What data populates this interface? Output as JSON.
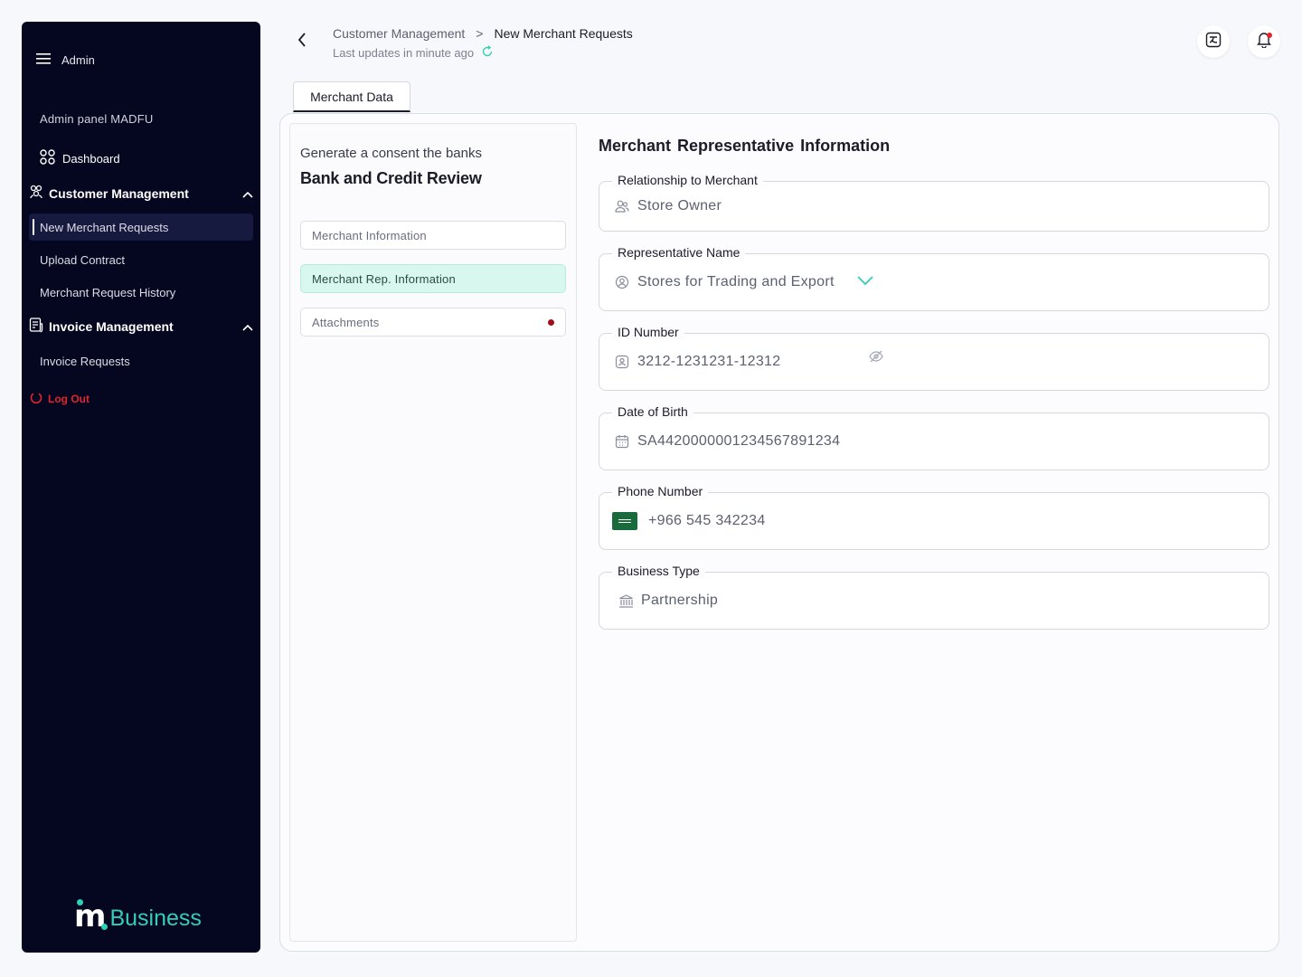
{
  "sidebar": {
    "admin_label": "Admin",
    "panel_title": "Admin panel MADFU",
    "dashboard_label": "Dashboard",
    "customer_section": "Customer Management",
    "customer_items": [
      "New Merchant Requests",
      "Upload Contract",
      "Merchant Request History"
    ],
    "invoice_section": "Invoice Management",
    "invoice_items": [
      "Invoice Requests"
    ],
    "logout_label": "Log Out",
    "logo_word": "Business",
    "active_item": "New Merchant Requests"
  },
  "header": {
    "breadcrumb_parent": "Customer Management",
    "breadcrumb_sep": ">",
    "breadcrumb_current": "New Merchant Requests",
    "last_updated": "Last updates in minute ago"
  },
  "tabs": [
    "Merchant Data"
  ],
  "left_panel": {
    "subtitle": "Generate a consent the banks",
    "title": "Bank and Credit Review",
    "steps": [
      {
        "label": "Merchant Information",
        "state": "default"
      },
      {
        "label": "Merchant Rep. Information",
        "state": "active"
      },
      {
        "label": "Attachments",
        "state": "alert"
      }
    ]
  },
  "form": {
    "title": "Merchant Representative Information",
    "fields": [
      {
        "label": "Relationship to Merchant",
        "value": "Store Owner",
        "icon": "users-icon"
      },
      {
        "label": "Representative Name",
        "value": "Stores  for Trading and Export",
        "icon": "user-badge-icon"
      },
      {
        "label": "ID Number",
        "value": "3212-1231231-12312",
        "icon": "id-card-icon"
      },
      {
        "label": "Date of Birth",
        "value": "SA4420000001234567891234",
        "icon": "calendar-icon"
      },
      {
        "label": "Phone Number",
        "value": "+966 545 342234",
        "icon": "saudi-flag-icon"
      },
      {
        "label": "Business Type",
        "value": "Partnership",
        "icon": "bank-icon"
      }
    ]
  },
  "colors": {
    "sidebar_bg": "#05061f",
    "accent": "#34cdb8",
    "active_step_bg": "#d7f7ef",
    "danger": "#e0262f"
  }
}
